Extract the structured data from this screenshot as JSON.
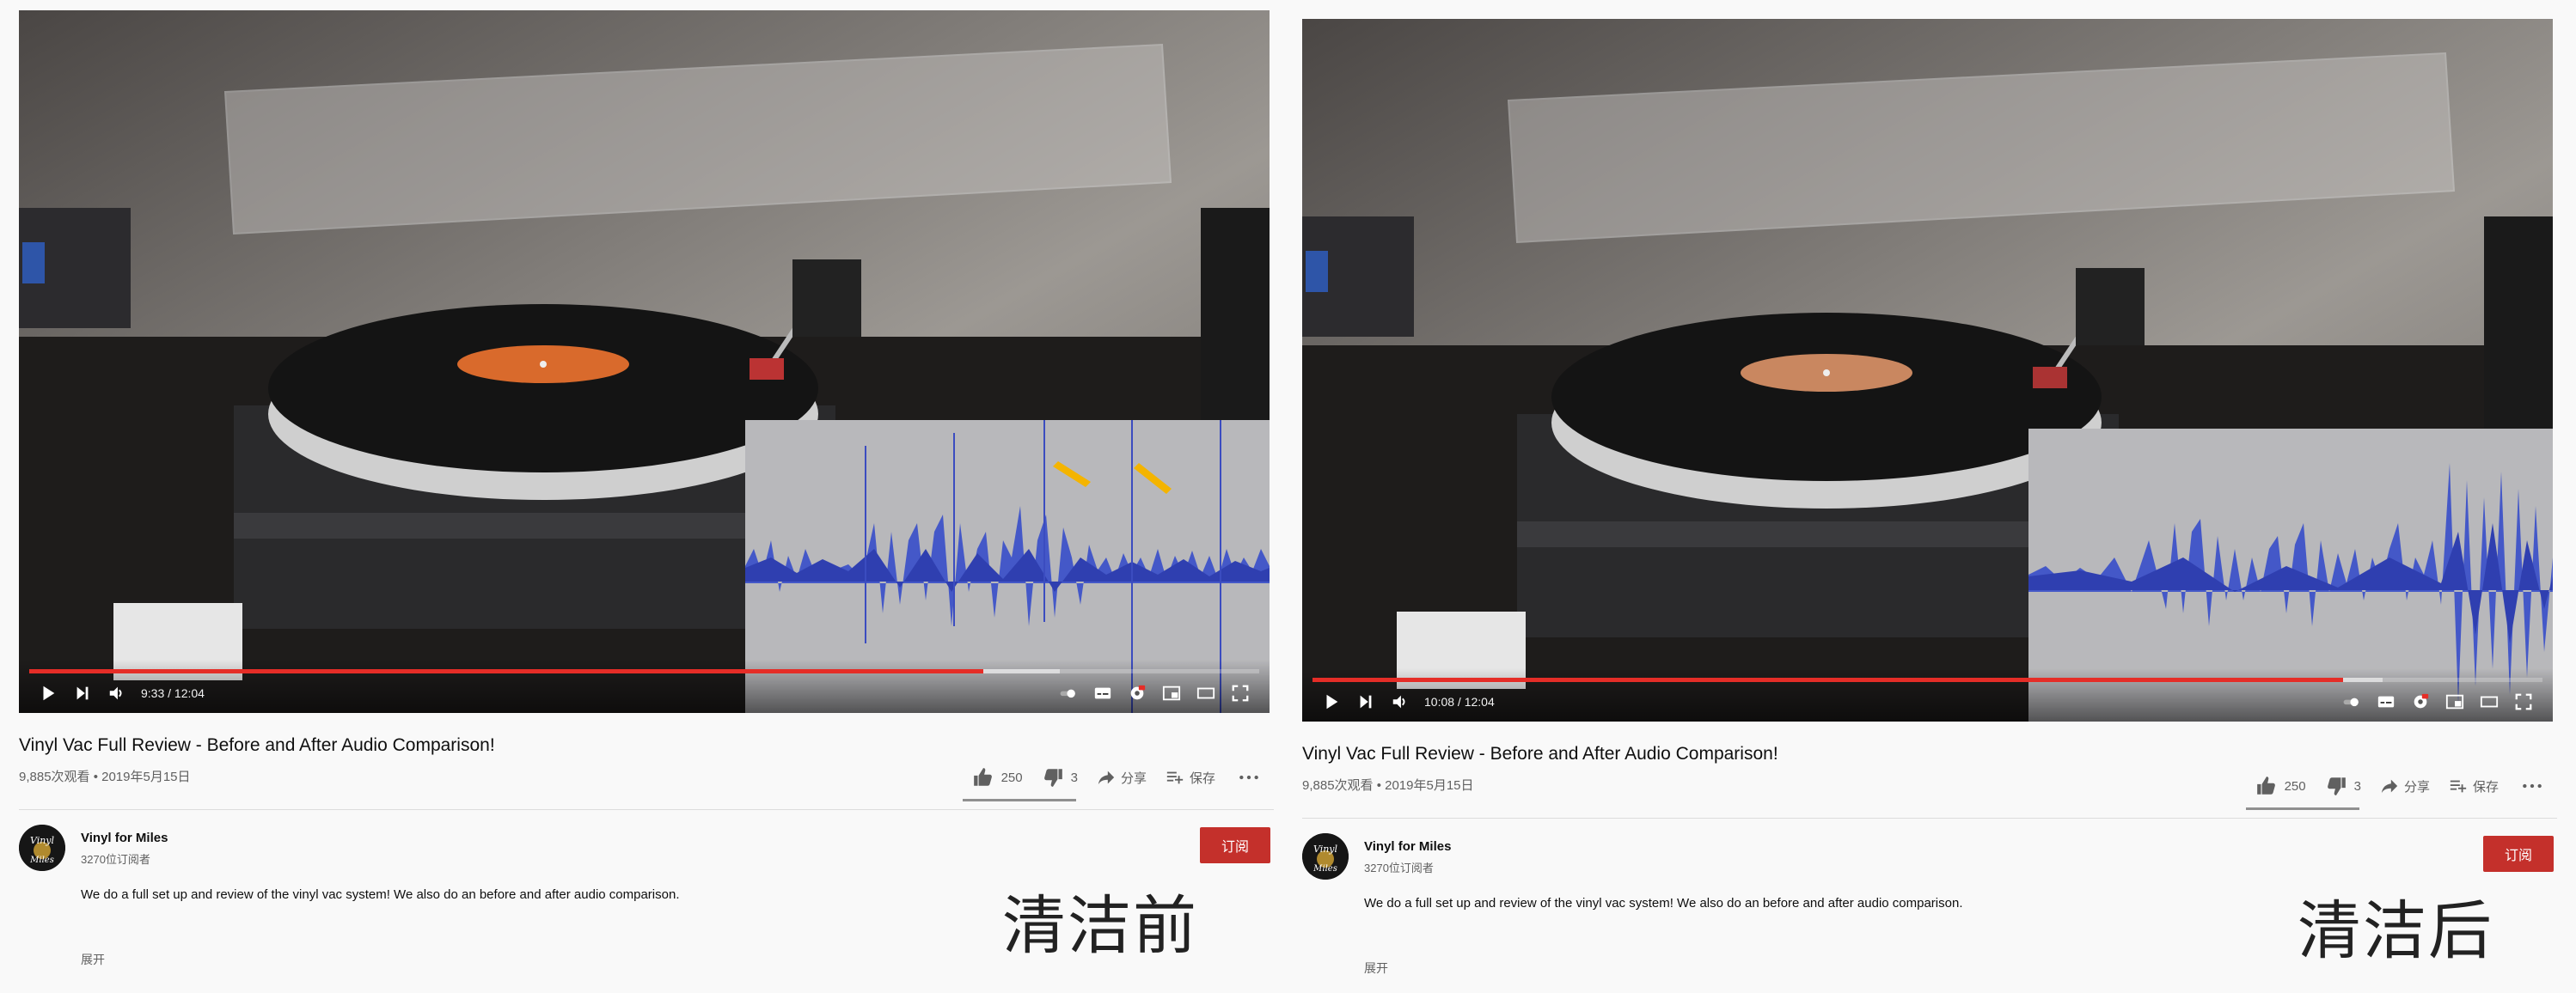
{
  "before": {
    "video": {
      "time": "9:33 / 12:04",
      "progress_played": 0.7758,
      "progress_buffered": 0.838
    },
    "title": "Vinyl Vac Full Review - Before and After Audio Comparison!",
    "meta": "9,885次观看 • 2019年5月15日",
    "actions": {
      "likes": "250",
      "dislikes": "3",
      "share": "分享",
      "save": "保存"
    },
    "channel": {
      "name": "Vinyl for Miles",
      "subscribers": "3270位订阅者",
      "subscribe_label": "订阅"
    },
    "description": "We do a full set up and review of the vinyl vac system! We also do an before and after audio comparison.",
    "expand_label": "展开",
    "overlay_label": "清洁前"
  },
  "after": {
    "video": {
      "time": "10:08 / 12:04",
      "progress_played": 0.8376,
      "progress_buffered": 0.87
    },
    "title": "Vinyl Vac Full Review - Before and After Audio Comparison!",
    "meta": "9,885次观看 • 2019年5月15日",
    "actions": {
      "likes": "250",
      "dislikes": "3",
      "share": "分享",
      "save": "保存"
    },
    "channel": {
      "name": "Vinyl for Miles",
      "subscribers": "3270位订阅者",
      "subscribe_label": "订阅"
    },
    "description": "We do a full set up and review of the vinyl vac system! We also do an before and after audio comparison.",
    "expand_label": "展开",
    "overlay_label": "清洁后"
  },
  "icons": [
    "play-icon",
    "next-icon",
    "volume-icon",
    "autoplay-toggle-icon",
    "subtitles-icon",
    "settings-icon",
    "miniplayer-icon",
    "theater-icon",
    "fullscreen-icon",
    "thumbs-up-icon",
    "thumbs-down-icon",
    "share-icon",
    "save-playlist-icon",
    "more-icon"
  ],
  "colors": {
    "progress": "#e52d27",
    "subscribe": "#c4302b",
    "waveform": "#3b4cc0"
  }
}
